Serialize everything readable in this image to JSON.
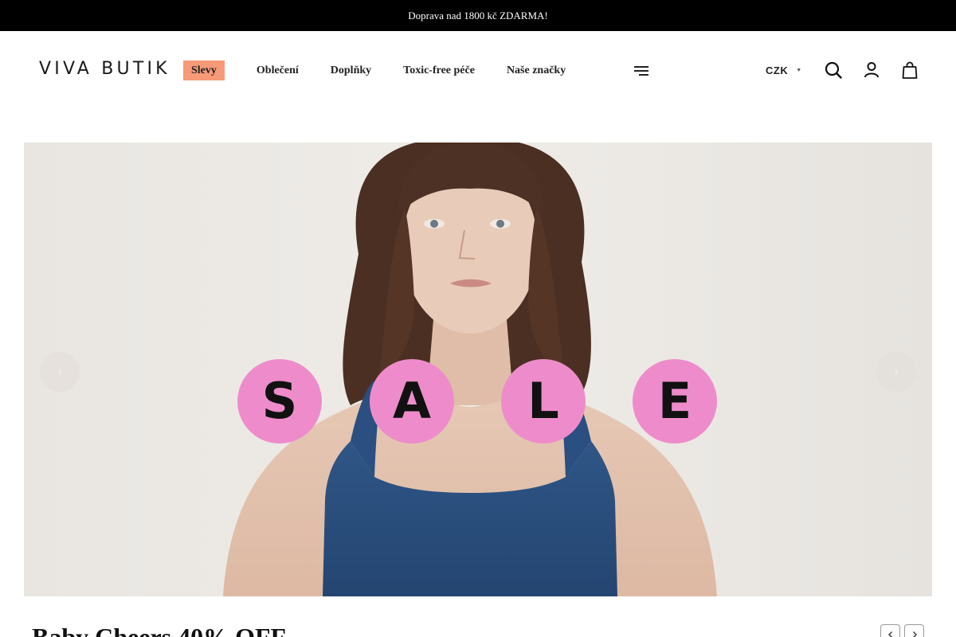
{
  "announcement": "Doprava nad 1800 kč ZDARMA!",
  "header": {
    "logo": "VIVA BUTIK",
    "nav": [
      {
        "label": "Slevy"
      },
      {
        "label": "Oblečení"
      },
      {
        "label": "Doplňky"
      },
      {
        "label": "Toxic-free péče"
      },
      {
        "label": "Naše značky"
      }
    ],
    "currency": "CZK",
    "icons": [
      "menu-icon",
      "search-icon",
      "account-icon",
      "cart-icon"
    ]
  },
  "hero": {
    "letters": [
      "S",
      "A",
      "L",
      "E"
    ],
    "circle_color": "#ee8ccb",
    "sale_tag_color": "#f79a78"
  },
  "section": {
    "title": "Baby Cheers 40% OFF"
  }
}
